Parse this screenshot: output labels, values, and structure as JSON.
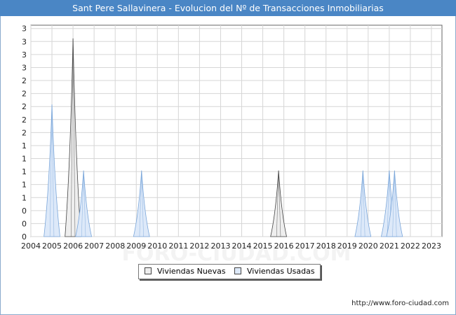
{
  "title": "Sant Pere Sallavinera - Evolucion del Nº de Transacciones Inmobiliarias",
  "footer_url": "http://www.foro-ciudad.com",
  "watermark": "FORO-CIUDAD.COM",
  "chart_data": {
    "type": "area",
    "title": "Sant Pere Sallavinera - Evolucion del Nº de Transacciones Inmobiliarias",
    "x_tick_labels": [
      "2004",
      "2005",
      "2006",
      "2007",
      "2008",
      "2009",
      "2010",
      "2011",
      "2012",
      "2013",
      "2014",
      "2015",
      "2016",
      "2017",
      "2018",
      "2019",
      "2020",
      "2021",
      "2022",
      "2023"
    ],
    "y_tick_labels": [
      "0",
      "0",
      "0",
      "1",
      "1",
      "1",
      "1",
      "1",
      "2",
      "2",
      "2",
      "2",
      "2",
      "3",
      "3",
      "3",
      "3"
    ],
    "ylim": [
      0,
      3.2
    ],
    "xlim": [
      2004,
      2023.5
    ],
    "grid": true,
    "legend_position": "bottom",
    "series": [
      {
        "name": "Viviendas Nuevas",
        "color": "#eeeeee",
        "stroke": "#444444",
        "points": [
          [
            2006,
            3
          ],
          [
            2015.75,
            1
          ]
        ]
      },
      {
        "name": "Viviendas Usadas",
        "color": "#dde9f9",
        "stroke": "#7aa6da",
        "points": [
          [
            2005,
            2
          ],
          [
            2006.5,
            1
          ],
          [
            2009.25,
            1
          ],
          [
            2019.75,
            1
          ],
          [
            2021,
            1
          ],
          [
            2021.25,
            1
          ]
        ]
      }
    ]
  }
}
